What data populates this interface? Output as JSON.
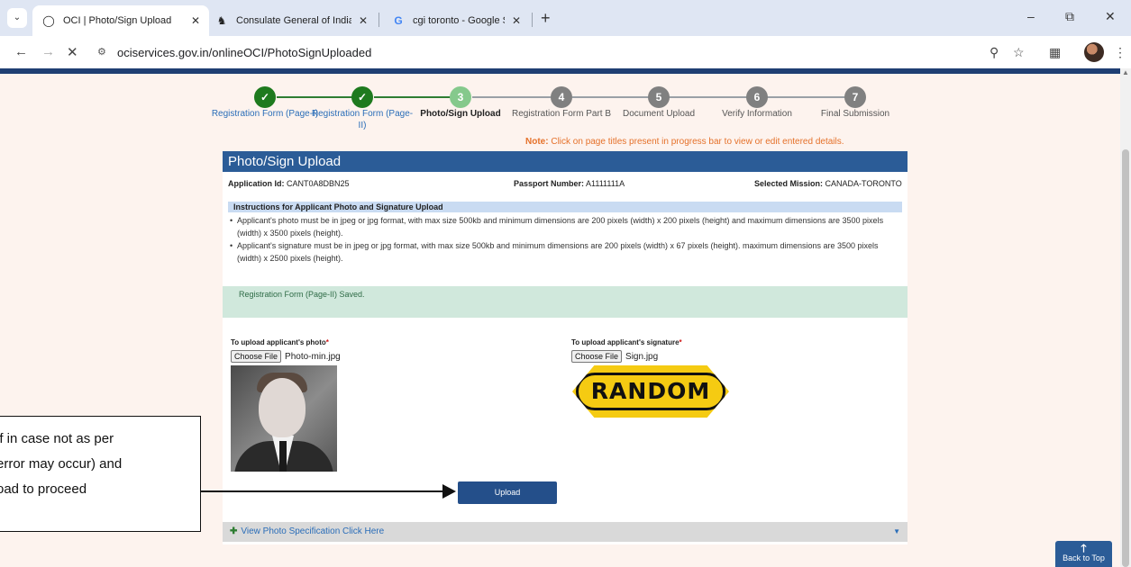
{
  "browser": {
    "tabs": [
      {
        "title": "OCI | Photo/Sign Upload",
        "icon": "oci-logo-icon",
        "active": true
      },
      {
        "title": "Consulate General of India, Toro",
        "icon": "emblem-icon",
        "active": false
      },
      {
        "title": "cgi toronto - Google Search",
        "icon": "google-icon",
        "active": false
      }
    ],
    "url": "ociservices.gov.in/onlineOCI/PhotoSignUploaded"
  },
  "stepper": {
    "steps": [
      {
        "number": "1",
        "label": "Registration Form (Page-I)",
        "status": "done"
      },
      {
        "number": "2",
        "label": "Registration Form (Page-II)",
        "status": "done"
      },
      {
        "number": "3",
        "label": "Photo/Sign Upload",
        "status": "current"
      },
      {
        "number": "4",
        "label": "Registration Form Part B",
        "status": "todo"
      },
      {
        "number": "5",
        "label": "Document Upload",
        "status": "todo"
      },
      {
        "number": "6",
        "label": "Verify Information",
        "status": "todo"
      },
      {
        "number": "7",
        "label": "Final Submission",
        "status": "todo"
      }
    ],
    "note_label": "Note:",
    "note_text": "Click on page titles present in progress bar to view or edit entered details."
  },
  "panel": {
    "title": "Photo/Sign Upload",
    "application_id_label": "Application Id:",
    "application_id": "CANT0A8DBN25",
    "passport_label": "Passport Number:",
    "passport_number": "A1111111A",
    "mission_label": "Selected Mission:",
    "mission": "CANADA-TORONTO",
    "instructions_title": "Instructions for Applicant Photo and Signature Upload",
    "instructions": [
      "Applicant's photo must be in jpeg or jpg format, with max size 500kb and minimum dimensions are 200 pixels (width) x 200 pixels (height) and maximum dimensions are 3500 pixels (width) x 3500 pixels (height).",
      "Applicant's signature must be in jpeg or jpg format, with max size 500kb and minimum dimensions are 200 pixels (width) x 67 pixels (height). maximum dimensions are 3500 pixels (width) x 2500 pixels (height)."
    ],
    "saved_message": "Registration Form (Page-II) Saved.",
    "photo_label": "To upload applicant's photo",
    "photo_file": "Photo-min.jpg",
    "sign_label": "To upload applicant's signature",
    "sign_file": "Sign.jpg",
    "required_mark": "*",
    "choose_file_label": "Choose File",
    "sign_image_text": "RANDOM",
    "upload_button": "Upload",
    "spec_link": "View Photo Specification Click Here"
  },
  "callout": {
    "lines": [
      "if in case not as per",
      "error may occur) and",
      "oad to proceed"
    ]
  },
  "back_to_top": "Back to Top",
  "colors": {
    "header_blue": "#2b5c97",
    "done_green": "#1e7a1e",
    "note_orange": "#e5712a",
    "saved_bg": "#d0e8dc",
    "page_bg": "#fdf3ee"
  }
}
